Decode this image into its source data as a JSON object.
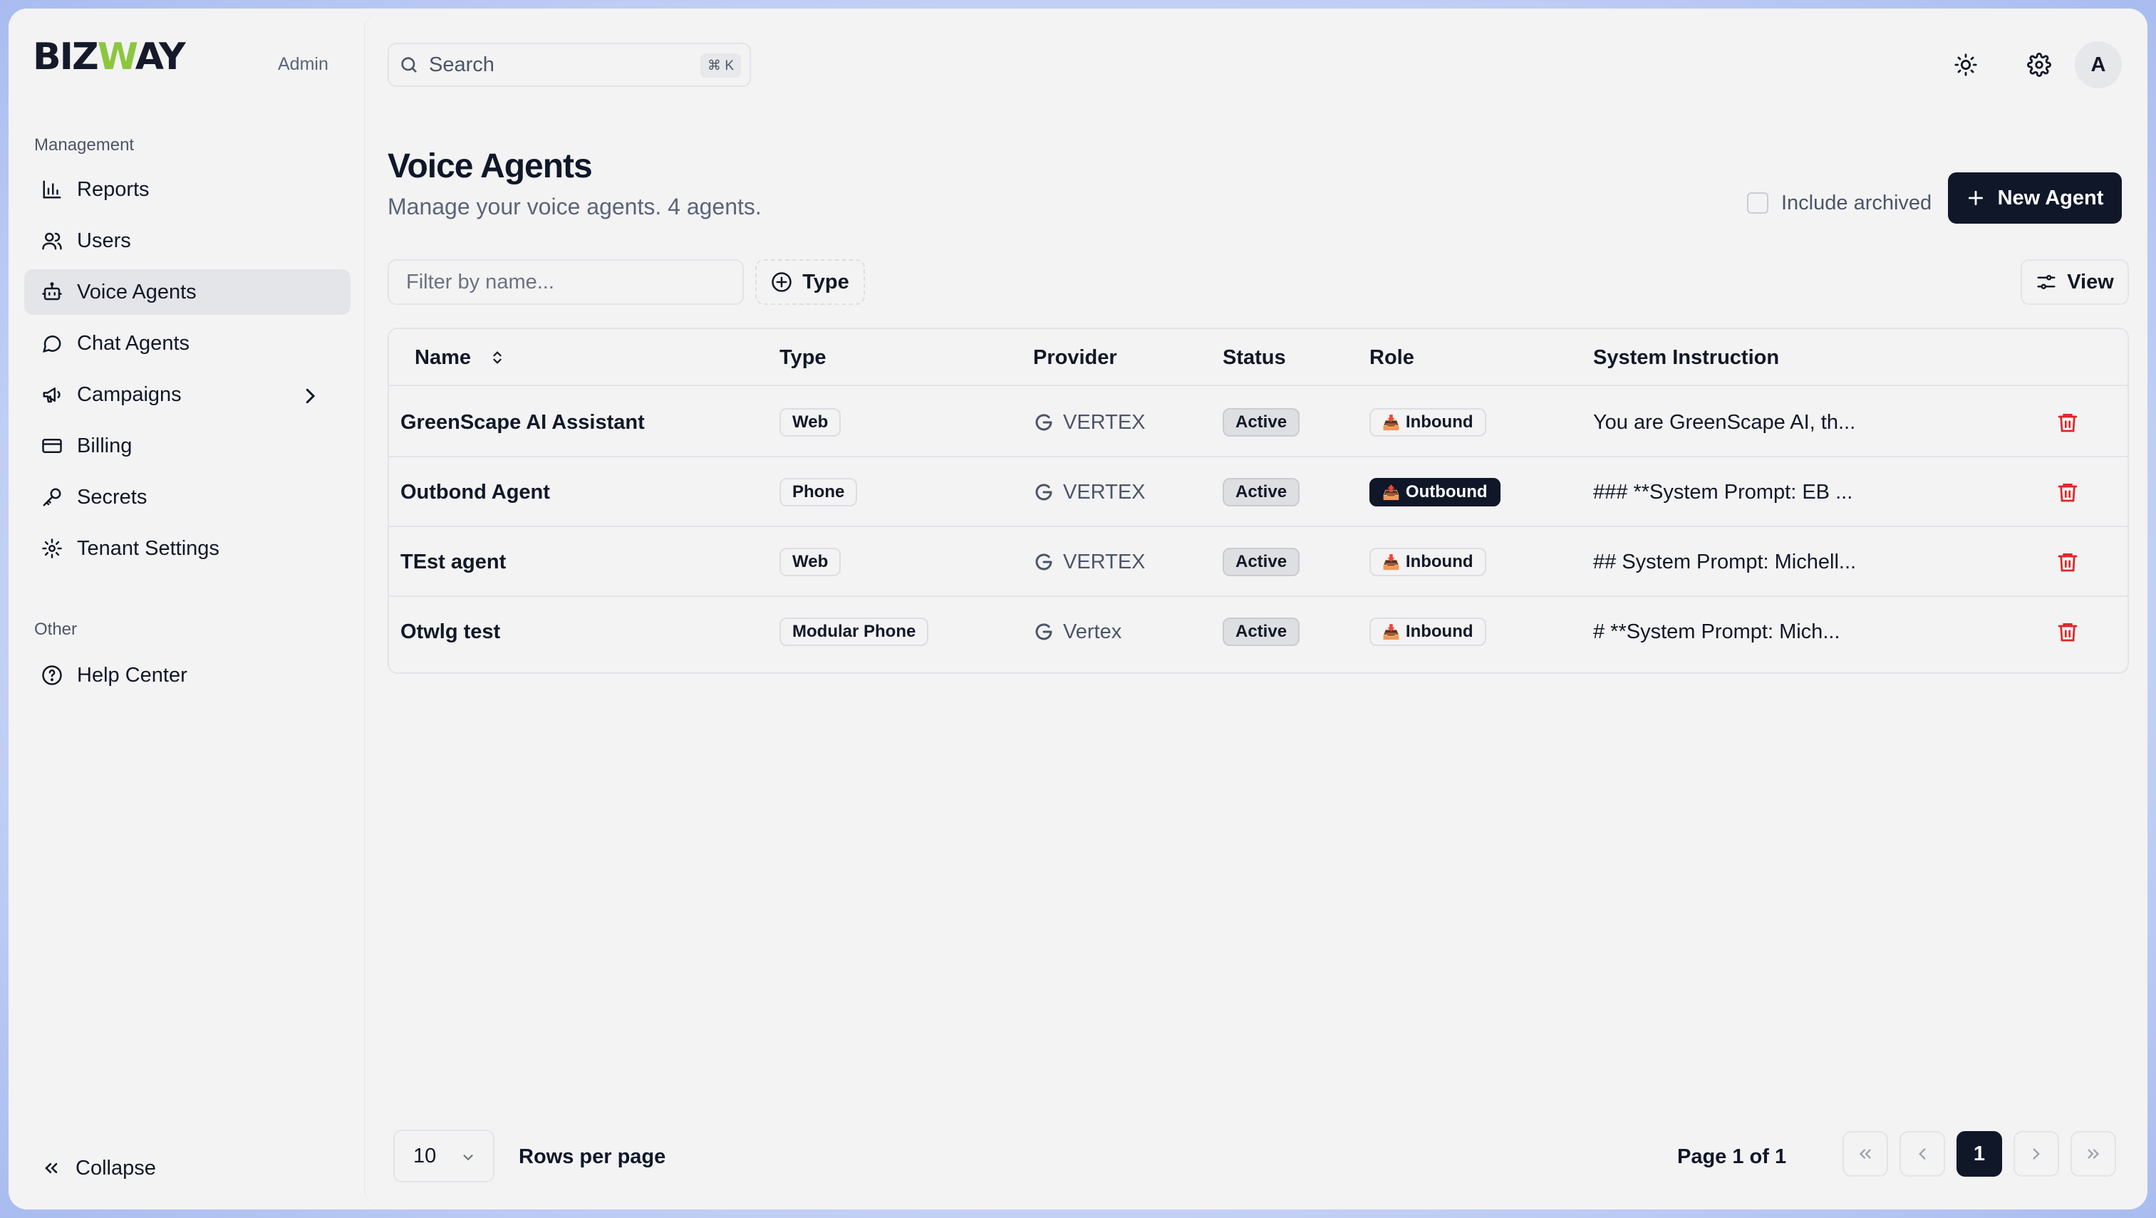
{
  "brand": {
    "logo_pre": "BIZ",
    "logo_w": "W",
    "logo_post": "AY",
    "role_label": "Admin",
    "accent": "#8cc63f"
  },
  "sidebar": {
    "section_management": "Management",
    "section_other": "Other",
    "items": [
      {
        "label": "Reports",
        "icon": "bar-chart-icon"
      },
      {
        "label": "Users",
        "icon": "users-icon"
      },
      {
        "label": "Voice Agents",
        "icon": "bot-icon",
        "active": true
      },
      {
        "label": "Chat Agents",
        "icon": "message-circle-icon"
      },
      {
        "label": "Campaigns",
        "icon": "megaphone-icon"
      },
      {
        "label": "Billing",
        "icon": "credit-card-icon"
      },
      {
        "label": "Secrets",
        "icon": "key-icon"
      },
      {
        "label": "Tenant Settings",
        "icon": "gear-icon"
      }
    ],
    "other_items": [
      {
        "label": "Help Center",
        "icon": "help-circle-icon"
      }
    ],
    "collapse_label": "Collapse"
  },
  "header": {
    "search_label": "Search",
    "search_shortcut": "⌘ K",
    "avatar_initial": "A"
  },
  "page": {
    "title": "Voice Agents",
    "subtitle": "Manage your voice agents. 4 agents.",
    "include_archived_label": "Include archived",
    "new_agent_label": "New Agent",
    "filter_placeholder": "Filter by name...",
    "type_filter_label": "Type",
    "view_label": "View"
  },
  "table": {
    "columns": [
      "Name",
      "Type",
      "Provider",
      "Status",
      "Role",
      "System Instruction"
    ],
    "rows": [
      {
        "name": "GreenScape AI Assistant",
        "type": "Web",
        "provider": "VERTEX",
        "status": "Active",
        "role": "Inbound",
        "role_emoji": "📥",
        "instruction": "You are GreenScape AI, th..."
      },
      {
        "name": "Outbond Agent",
        "type": "Phone",
        "provider": "VERTEX",
        "status": "Active",
        "role": "Outbound",
        "role_emoji": "📤",
        "instruction": "### **System Prompt: EB ..."
      },
      {
        "name": "TEst agent",
        "type": "Web",
        "provider": "VERTEX",
        "status": "Active",
        "role": "Inbound",
        "role_emoji": "📥",
        "instruction": "## System Prompt: Michell..."
      },
      {
        "name": "Otwlg test",
        "type": "Modular Phone",
        "provider": "Vertex",
        "status": "Active",
        "role": "Inbound",
        "role_emoji": "📥",
        "instruction": "# **System Prompt: Mich..."
      }
    ]
  },
  "pagination": {
    "rows_per_page_value": "10",
    "rows_per_page_label": "Rows per page",
    "page_info": "Page 1 of 1",
    "current_page": "1"
  },
  "colors": {
    "primary": "#0f1729",
    "danger": "#dc2626",
    "background": "#f3f3f4"
  }
}
